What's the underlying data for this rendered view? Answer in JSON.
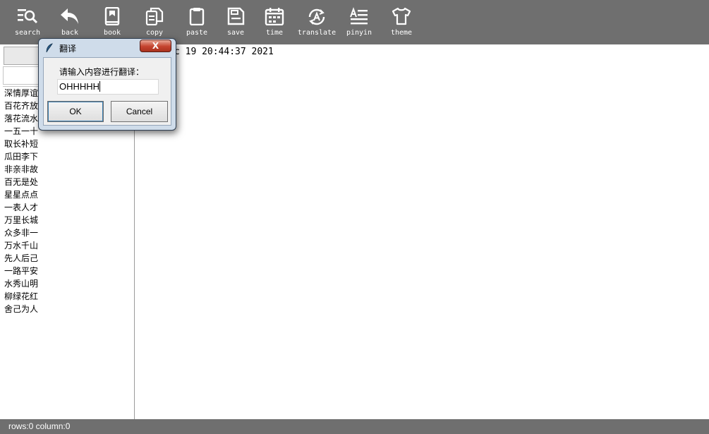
{
  "toolbar": {
    "items": [
      {
        "label": "search",
        "icon": "search-icon"
      },
      {
        "label": "back",
        "icon": "back-arrow-icon"
      },
      {
        "label": "book",
        "icon": "book-icon"
      },
      {
        "label": "copy",
        "icon": "copy-icon"
      },
      {
        "label": "paste",
        "icon": "clipboard-icon"
      },
      {
        "label": "save",
        "icon": "floppy-icon"
      },
      {
        "label": "time",
        "icon": "calendar-icon"
      },
      {
        "label": "translate",
        "icon": "translate-icon"
      },
      {
        "label": "pinyin",
        "icon": "text-lines-icon"
      },
      {
        "label": "theme",
        "icon": "tshirt-icon"
      }
    ]
  },
  "sidebar": {
    "items": [
      "深情厚谊",
      "百花齐放",
      "落花流水",
      "一五一十",
      "取长补短",
      "瓜田李下",
      "非亲非故",
      "百无是处",
      "星星点点",
      "一表人才",
      "万里长城",
      "众多非一",
      "万水千山",
      "先人后己",
      "一路平安",
      "水秀山明",
      "柳绿花红",
      "舍己为人"
    ]
  },
  "editor": {
    "text": "Sun Dec 19 20:44:37 2021"
  },
  "status": {
    "text": "rows:0 column:0"
  },
  "dialog": {
    "title": "翻译",
    "close_label": "X",
    "prompt": "请输入内容进行翻译：",
    "input_value": "OHHHHH",
    "ok_label": "OK",
    "cancel_label": "Cancel"
  },
  "colors": {
    "toolbar_bg": "#6f6f6f",
    "dialog_frame": "#cfdcea",
    "close_red": "#c5432f"
  }
}
